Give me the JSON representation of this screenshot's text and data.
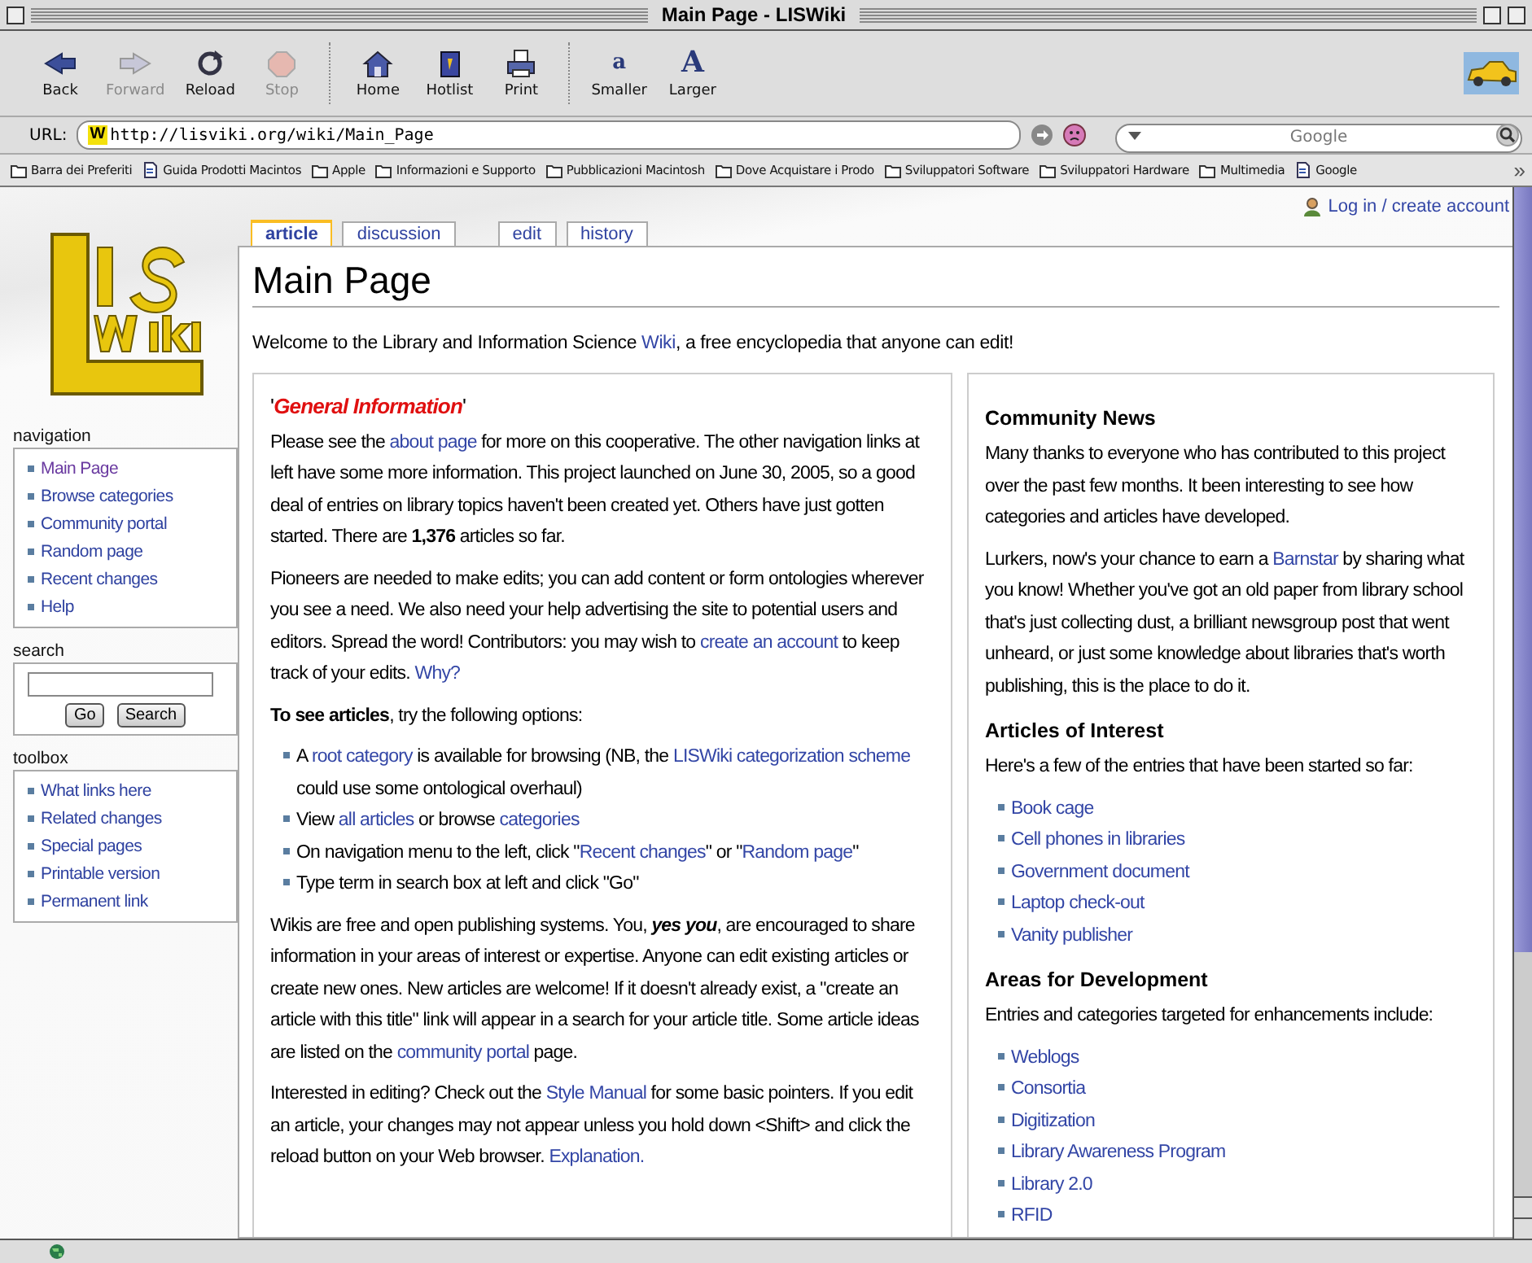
{
  "window": {
    "title": "Main Page - LISWiki"
  },
  "toolbar": {
    "groups": [
      [
        {
          "kind": "back",
          "label": "Back",
          "disabled": false
        },
        {
          "kind": "forward",
          "label": "Forward",
          "disabled": true
        },
        {
          "kind": "reload",
          "label": "Reload",
          "disabled": false
        },
        {
          "kind": "stop",
          "label": "Stop",
          "disabled": true
        }
      ],
      [
        {
          "kind": "home",
          "label": "Home",
          "disabled": false
        },
        {
          "kind": "hotlist",
          "label": "Hotlist",
          "disabled": false
        },
        {
          "kind": "print",
          "label": "Print",
          "disabled": false
        }
      ],
      [
        {
          "kind": "smaller",
          "label": "Smaller",
          "glyph": "a",
          "disabled": false
        },
        {
          "kind": "larger",
          "label": "Larger",
          "glyph": "A",
          "disabled": false
        }
      ]
    ]
  },
  "address_bar": {
    "label": "URL:",
    "favicon": "W",
    "value": "http://lisviki.org/wiki/Main_Page",
    "search_placeholder": "Google"
  },
  "bookmarks": {
    "items": [
      {
        "kind": "folder",
        "label": "Barra dei Preferiti"
      },
      {
        "kind": "page",
        "label": "Guida Prodotti Macintos"
      },
      {
        "kind": "folder",
        "label": "Apple"
      },
      {
        "kind": "folder",
        "label": "Informazioni e Supporto"
      },
      {
        "kind": "folder",
        "label": "Pubblicazioni Macintosh"
      },
      {
        "kind": "folder",
        "label": "Dove Acquistare i Prodo"
      },
      {
        "kind": "folder",
        "label": "Sviluppatori Software"
      },
      {
        "kind": "folder",
        "label": "Sviluppatori Hardware"
      },
      {
        "kind": "folder",
        "label": "Multimedia"
      },
      {
        "kind": "page",
        "label": "Google"
      }
    ],
    "overflow": "»"
  },
  "wiki": {
    "personal": "Log in / create account",
    "tabs": [
      {
        "label": "article",
        "selected": true
      },
      {
        "label": "discussion",
        "selected": false
      },
      {
        "label": "edit",
        "selected": false
      },
      {
        "label": "history",
        "selected": false
      }
    ],
    "sidebar": [
      {
        "kind": "links",
        "title": "navigation",
        "items": [
          {
            "label": "Main Page",
            "visited": true
          },
          {
            "label": "Browse categories",
            "visited": false
          },
          {
            "label": "Community portal",
            "visited": false
          },
          {
            "label": "Random page",
            "visited": false
          },
          {
            "label": "Recent changes",
            "visited": false
          },
          {
            "label": "Help",
            "visited": false
          }
        ]
      },
      {
        "kind": "search",
        "title": "search",
        "buttons": [
          "Go",
          "Search"
        ]
      },
      {
        "kind": "links",
        "title": "toolbox",
        "items": [
          {
            "label": "What links here",
            "visited": false
          },
          {
            "label": "Related changes",
            "visited": false
          },
          {
            "label": "Special pages",
            "visited": false
          },
          {
            "label": "Printable version",
            "visited": false
          },
          {
            "label": "Permanent link",
            "visited": false
          }
        ]
      }
    ],
    "title": "Main Page",
    "intro": [
      {
        "text": "Welcome to the Library and Information Science "
      },
      {
        "kind": "link",
        "text": "Wiki"
      },
      {
        "text": ", a free encyclopedia that anyone can edit!"
      }
    ],
    "columns": [
      {
        "blocks": [
          {
            "kind": "banner",
            "parts": [
              {
                "text": "'"
              },
              {
                "kind": "emphasis",
                "text": "General Information"
              },
              {
                "text": "'"
              }
            ]
          },
          {
            "kind": "paragraph",
            "parts": [
              {
                "text": "Please see the "
              },
              {
                "kind": "link",
                "text": "about page"
              },
              {
                "text": " for more on this cooperative. The other navigation links at left have some more information. This project launched on June 30, 2005, so a good deal of entries on library topics haven't been created yet. Others have just gotten started. There are **1,376** articles so far."
              }
            ]
          },
          {
            "kind": "paragraph",
            "parts": [
              {
                "text": "Pioneers are needed to make edits; you can add content or form ontologies wherever you see a need. We also need your help advertising the site to potential users and editors. Spread the word! Contributors: you may wish to "
              },
              {
                "kind": "link",
                "text": "create an account"
              },
              {
                "text": " to keep track of your edits. "
              },
              {
                "kind": "link",
                "text": "Why?"
              }
            ]
          },
          {
            "kind": "paragraph",
            "parts": [
              {
                "text": "**To see articles**, try the following options:"
              }
            ]
          },
          {
            "kind": "list",
            "items": [
              [
                {
                  "text": "A "
                },
                {
                  "kind": "link",
                  "text": "root category"
                },
                {
                  "text": " is available for browsing (NB, the "
                },
                {
                  "kind": "link",
                  "text": "LISWiki categorization scheme"
                },
                {
                  "text": " could use some ontological overhaul)"
                }
              ],
              [
                {
                  "text": "View "
                },
                {
                  "kind": "link",
                  "text": "all articles"
                },
                {
                  "text": " or browse "
                },
                {
                  "kind": "link",
                  "text": "categories"
                }
              ],
              [
                {
                  "text": "On navigation menu to the left, click \""
                },
                {
                  "kind": "link",
                  "text": "Recent changes"
                },
                {
                  "text": "\" or \""
                },
                {
                  "kind": "link",
                  "text": "Random page"
                },
                {
                  "text": "\""
                }
              ],
              [
                {
                  "text": "Type term in search box at left and click \"Go\""
                }
              ]
            ]
          },
          {
            "kind": "paragraph",
            "parts": [
              {
                "text": "Wikis are free and open publishing systems. You, "
              },
              {
                "kind": "strong",
                "text": "yes you"
              },
              {
                "text": ", are encouraged to share information in your areas of interest or expertise. Anyone can edit existing articles or create new ones. New articles are welcome! If it doesn't already exist, a \"create an article with this title\" link will appear in a search for your article title. Some article ideas are listed on the "
              },
              {
                "kind": "link",
                "text": "community portal"
              },
              {
                "text": " page."
              }
            ]
          },
          {
            "kind": "paragraph",
            "parts": [
              {
                "text": "Interested in editing? Check out the "
              },
              {
                "kind": "link",
                "text": "Style Manual"
              },
              {
                "text": " for some basic pointers. If you edit an article, your changes may not appear unless you hold down <Shift> and click the reload button on your Web browser. "
              },
              {
                "kind": "link",
                "text": "Explanation."
              }
            ]
          }
        ]
      },
      {
        "blocks": [
          {
            "kind": "heading",
            "text": "Community News"
          },
          {
            "kind": "paragraph",
            "parts": [
              {
                "text": "Many thanks to everyone who has contributed to this project over the past few months. It been interesting to see how categories and articles have developed."
              }
            ]
          },
          {
            "kind": "paragraph",
            "parts": [
              {
                "text": "Lurkers, now's your chance to earn a "
              },
              {
                "kind": "link",
                "text": "Barnstar"
              },
              {
                "text": " by sharing what you know! Whether you've got an old paper from library school that's just collecting dust, a brilliant newsgroup post that went unheard, or just some knowledge about libraries that's worth publishing, this is the place to do it."
              }
            ]
          },
          {
            "kind": "heading",
            "text": "Articles of Interest"
          },
          {
            "kind": "paragraph",
            "parts": [
              {
                "text": "Here's a few of the entries that have been started so far:"
              }
            ]
          },
          {
            "kind": "list",
            "items": [
              [
                {
                  "kind": "link",
                  "text": "Book cage"
                }
              ],
              [
                {
                  "kind": "link",
                  "text": "Cell phones in libraries"
                }
              ],
              [
                {
                  "kind": "link",
                  "text": "Government document"
                }
              ],
              [
                {
                  "kind": "link",
                  "text": "Laptop check-out"
                }
              ],
              [
                {
                  "kind": "link",
                  "text": "Vanity publisher"
                }
              ]
            ]
          },
          {
            "kind": "heading",
            "text": "Areas for Development"
          },
          {
            "kind": "paragraph",
            "parts": [
              {
                "text": "Entries and categories targeted for enhancements include:"
              }
            ]
          },
          {
            "kind": "list",
            "items": [
              [
                {
                  "kind": "link",
                  "text": "Weblogs"
                }
              ],
              [
                {
                  "kind": "link",
                  "text": "Consortia"
                }
              ],
              [
                {
                  "kind": "link",
                  "text": "Digitization"
                }
              ],
              [
                {
                  "kind": "link",
                  "text": "Library Awareness Program"
                }
              ],
              [
                {
                  "kind": "link",
                  "text": "Library 2.0"
                }
              ],
              [
                {
                  "kind": "link",
                  "text": "RFID"
                }
              ]
            ]
          }
        ]
      }
    ]
  }
}
